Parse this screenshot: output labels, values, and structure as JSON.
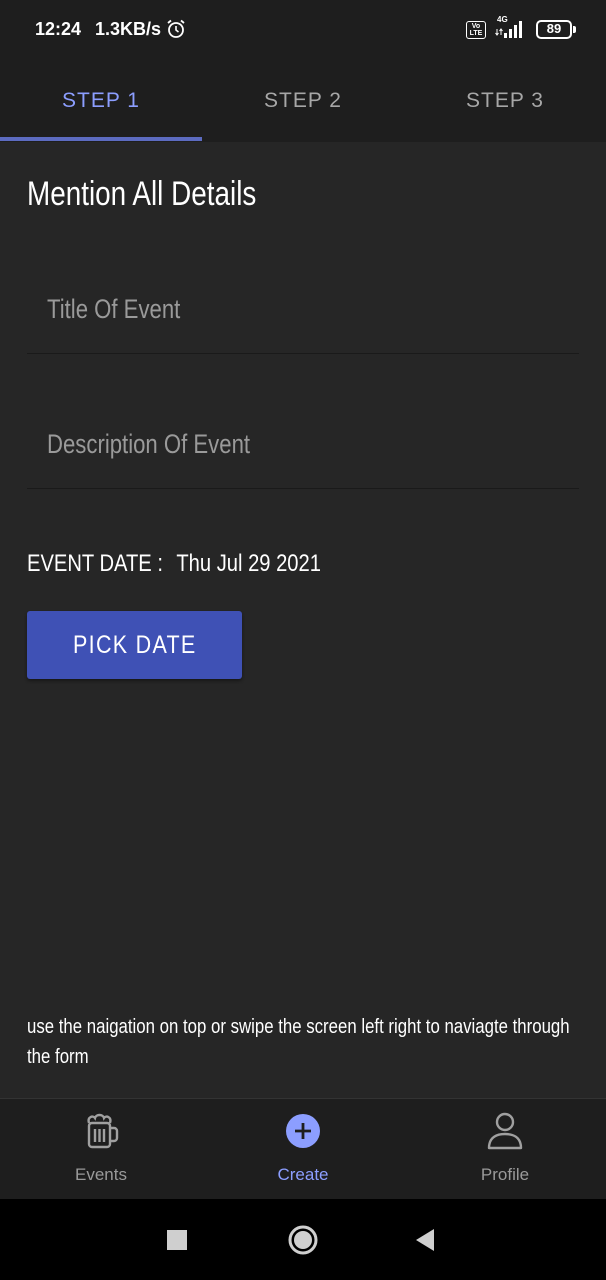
{
  "status_bar": {
    "time": "12:24",
    "speed": "1.3KB/s",
    "volte": "Vo LTE",
    "network": "4G",
    "battery": "89"
  },
  "tabs": [
    {
      "label": "STEP 1",
      "active": true
    },
    {
      "label": "STEP 2",
      "active": false
    },
    {
      "label": "STEP 3",
      "active": false
    }
  ],
  "form": {
    "title": "Mention All Details",
    "title_field": {
      "value": "",
      "placeholder": "Title Of Event"
    },
    "description_field": {
      "value": "",
      "placeholder": "Description Of Event"
    },
    "event_date_label": "EVENT DATE :",
    "event_date_value": "Thu Jul 29 2021",
    "pick_date_label": "PICK DATE",
    "help_text": "use the naigation on top or swipe the screen left right to naviagte through the form"
  },
  "bottom_nav": [
    {
      "label": "Events",
      "icon": "beer-mug-icon",
      "active": false
    },
    {
      "label": "Create",
      "icon": "plus-circle-icon",
      "active": true
    },
    {
      "label": "Profile",
      "icon": "person-icon",
      "active": false
    }
  ],
  "colors": {
    "accent": "#3f51b5",
    "accent_light": "#8c9eff",
    "background": "#262626",
    "bar_background": "#1e1e1e"
  }
}
